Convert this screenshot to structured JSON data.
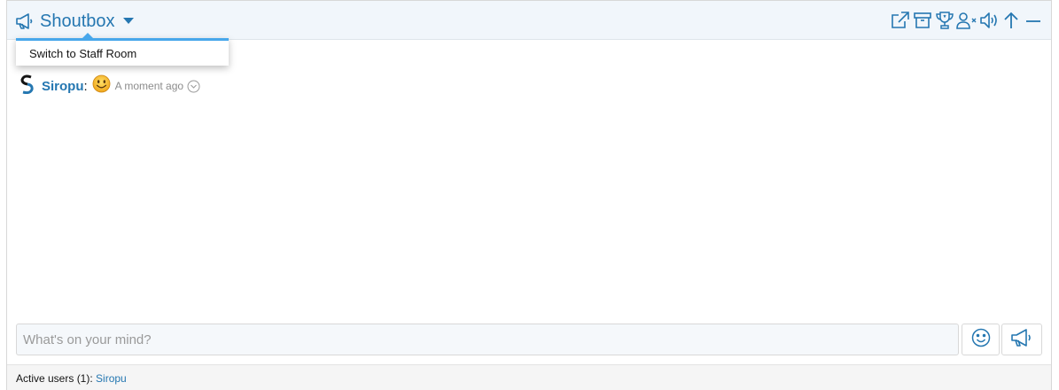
{
  "header": {
    "title": "Shoutbox",
    "toolbar_icons": [
      "external-link-icon",
      "archive-icon",
      "trophy-icon",
      "user-remove-icon",
      "volume-icon",
      "arrow-up-icon",
      "minimize-icon"
    ]
  },
  "dropdown": {
    "items": [
      {
        "label": "Switch to Staff Room"
      }
    ]
  },
  "messages": [
    {
      "user": "Siropu",
      "separator": ":",
      "content_icon": "smile-emoji",
      "time": "A moment ago"
    }
  ],
  "composer": {
    "placeholder": "What's on your mind?",
    "emoji_icon": "smiley-icon",
    "send_icon": "megaphone-icon"
  },
  "footer": {
    "label": "Active users (1):",
    "users": [
      "Siropu"
    ]
  },
  "colors": {
    "accent": "#2577b1",
    "header_bg": "#f1f6fb",
    "dropdown_border": "#47a7eb",
    "footer_bg": "#f5f5f5"
  }
}
